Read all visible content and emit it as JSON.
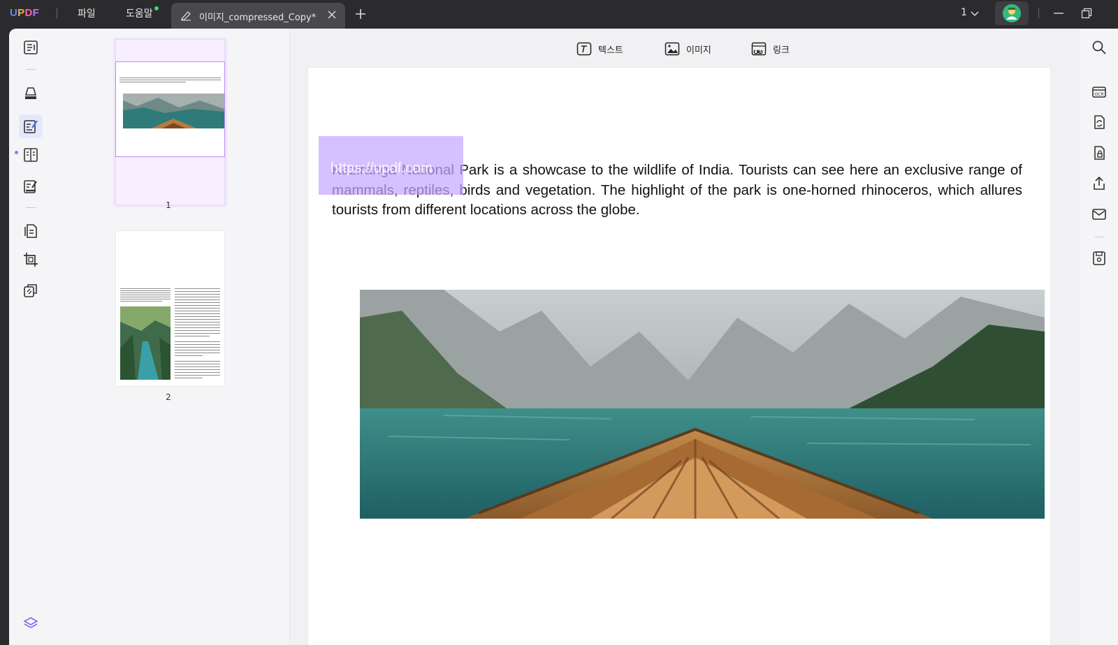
{
  "app": {
    "logo": [
      "U",
      "P",
      "D",
      "F"
    ],
    "menus": [
      "파일",
      "도움말"
    ],
    "tab_title": "이미지_compressed_Copy*",
    "page_number": "1"
  },
  "toolbar": {
    "text_label": "텍스트",
    "image_label": "이미지",
    "link_label": "링크"
  },
  "thumbnails": [
    {
      "label": "1",
      "selected": true
    },
    {
      "label": "2",
      "selected": false
    }
  ],
  "document": {
    "paragraph": "Kaziranga National Park is a showcase to the wildlife of India. Tourists can see here an exclusive range of mammals, reptiles, birds and vegetation. The highlight of the park is one-horned rhinoceros, which allures tourists from different locations across the globe.",
    "link_url": "https://updf.com"
  },
  "icons": {
    "left_rail": [
      "reader-icon",
      "comment-icon",
      "edit-pdf-icon",
      "form-icon",
      "fill-sign-icon",
      "organize-pages-icon",
      "crop-icon",
      "page-tools-icon",
      "layers-icon"
    ],
    "right_rail": [
      "search-icon",
      "ocr-icon",
      "convert-icon",
      "protect-icon",
      "share-icon",
      "email-icon",
      "save-icon"
    ]
  },
  "colors": {
    "accent": "#8b7cf6",
    "link_highlight": "#c6a8ff",
    "titlebar": "#2b2b2e"
  }
}
